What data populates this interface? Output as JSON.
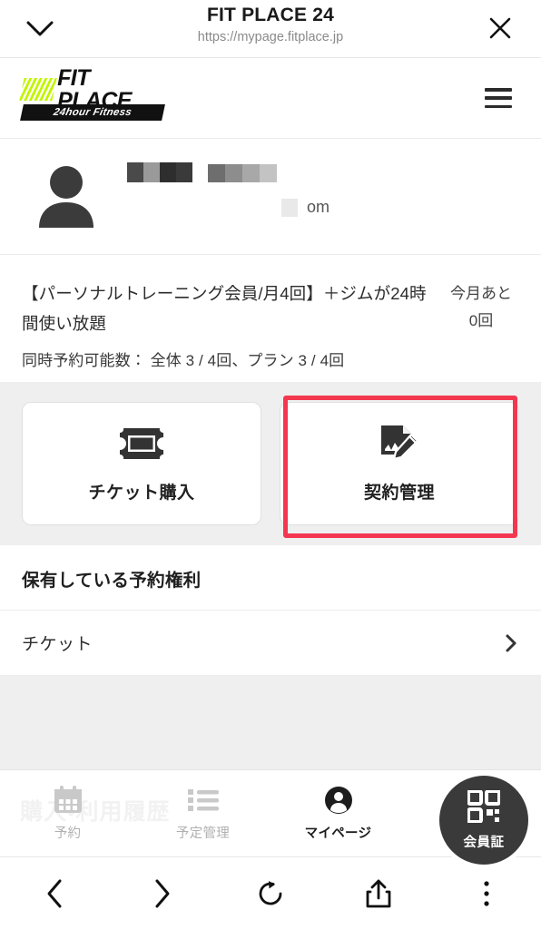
{
  "browser_header": {
    "title": "FIT PLACE 24",
    "url": "https://mypage.fitplace.jp",
    "collapse_icon": "chevron-down-icon",
    "close_icon": "close-icon"
  },
  "site_header": {
    "logo_word": "FIT PLACE",
    "logo_sub": "24hour Fitness",
    "menu_icon": "hamburger-menu-icon"
  },
  "profile": {
    "avatar_icon": "user-avatar-icon",
    "name_redacted": true,
    "email_suffix": "om"
  },
  "plan": {
    "name": "【パーソナルトレーニング会員/月4回】＋ジムが24時間使い放題",
    "remaining_label": "今月あと",
    "remaining_value": "0回",
    "concurrent_reservations": "同時予約可能数： 全体 3 / 4回、プラン 3 / 4回"
  },
  "action_cards": [
    {
      "label": "チケット購入",
      "icon": "ticket-icon",
      "highlighted": false
    },
    {
      "label": "契約管理",
      "icon": "contract-edit-icon",
      "highlighted": true
    }
  ],
  "highlight_color": "#f4374f",
  "rights_section": {
    "title": "保有している予約権利",
    "rows": [
      {
        "label": "チケット",
        "chevron": "chevron-right-icon"
      }
    ]
  },
  "tabbar": {
    "ghost_text": "購入・利用履歴",
    "tabs": [
      {
        "label": "予約",
        "icon": "calendar-icon",
        "active": false
      },
      {
        "label": "予定管理",
        "icon": "list-icon",
        "active": false
      },
      {
        "label": "マイページ",
        "icon": "person-icon",
        "active": true
      }
    ],
    "fab": {
      "label": "会員証",
      "icon": "qr-code-icon"
    }
  },
  "browser_nav": {
    "buttons": [
      {
        "name": "back",
        "icon": "chevron-left-icon"
      },
      {
        "name": "forward",
        "icon": "chevron-right-icon"
      },
      {
        "name": "reload",
        "icon": "reload-icon"
      },
      {
        "name": "share",
        "icon": "share-icon"
      },
      {
        "name": "more",
        "icon": "more-vertical-icon"
      }
    ]
  }
}
